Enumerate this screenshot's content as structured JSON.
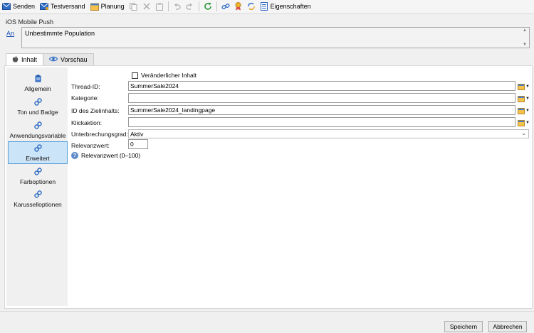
{
  "toolbar": {
    "send": "Senden",
    "test_send": "Testversand",
    "planning": "Planung",
    "properties": "Eigenschaften"
  },
  "header": {
    "title": "iOS Mobile Push",
    "to_link": "An",
    "population": "Unbestimmte Population"
  },
  "tabs": [
    {
      "label": "Inhalt",
      "icon": "apple-icon"
    },
    {
      "label": "Vorschau",
      "icon": "eye-icon"
    }
  ],
  "sidebar": {
    "items": [
      {
        "label": "Allgemein",
        "icon": "clipboard-icon"
      },
      {
        "label": "Ton und Badge",
        "icon": "gears-icon"
      },
      {
        "label": "Anwendungsvariable",
        "icon": "gears-icon"
      },
      {
        "label": "Erweitert",
        "icon": "gears-icon",
        "active": true
      },
      {
        "label": "Farboptionen",
        "icon": "gears-icon"
      },
      {
        "label": "Karusselloptionen",
        "icon": "gears-icon"
      }
    ]
  },
  "form": {
    "variable_content_label": "Veränderlicher Inhalt",
    "thread_id_label": "Thread-ID:",
    "thread_id_value": "SummerSale2024",
    "category_label": "Kategorie:",
    "category_value": "",
    "target_content_label": "ID des Zielinhalts:",
    "target_content_value": "SummerSale2024_landingpage",
    "click_action_label": "Klickaktion:",
    "click_action_value": "",
    "interruption_label": "Unterbrechungsgrad:",
    "interruption_value": "Aktiv",
    "relevance_label": "Relevanzwert:",
    "relevance_value": "0",
    "relevance_help": "Relevanzwert (0–100)"
  },
  "buttons": {
    "save": "Speichern",
    "cancel": "Abbrechen"
  },
  "colors": {
    "accent": "#1a4fb6",
    "active_item_bg": "#cce4f7",
    "active_item_border": "#5aa0d8"
  }
}
